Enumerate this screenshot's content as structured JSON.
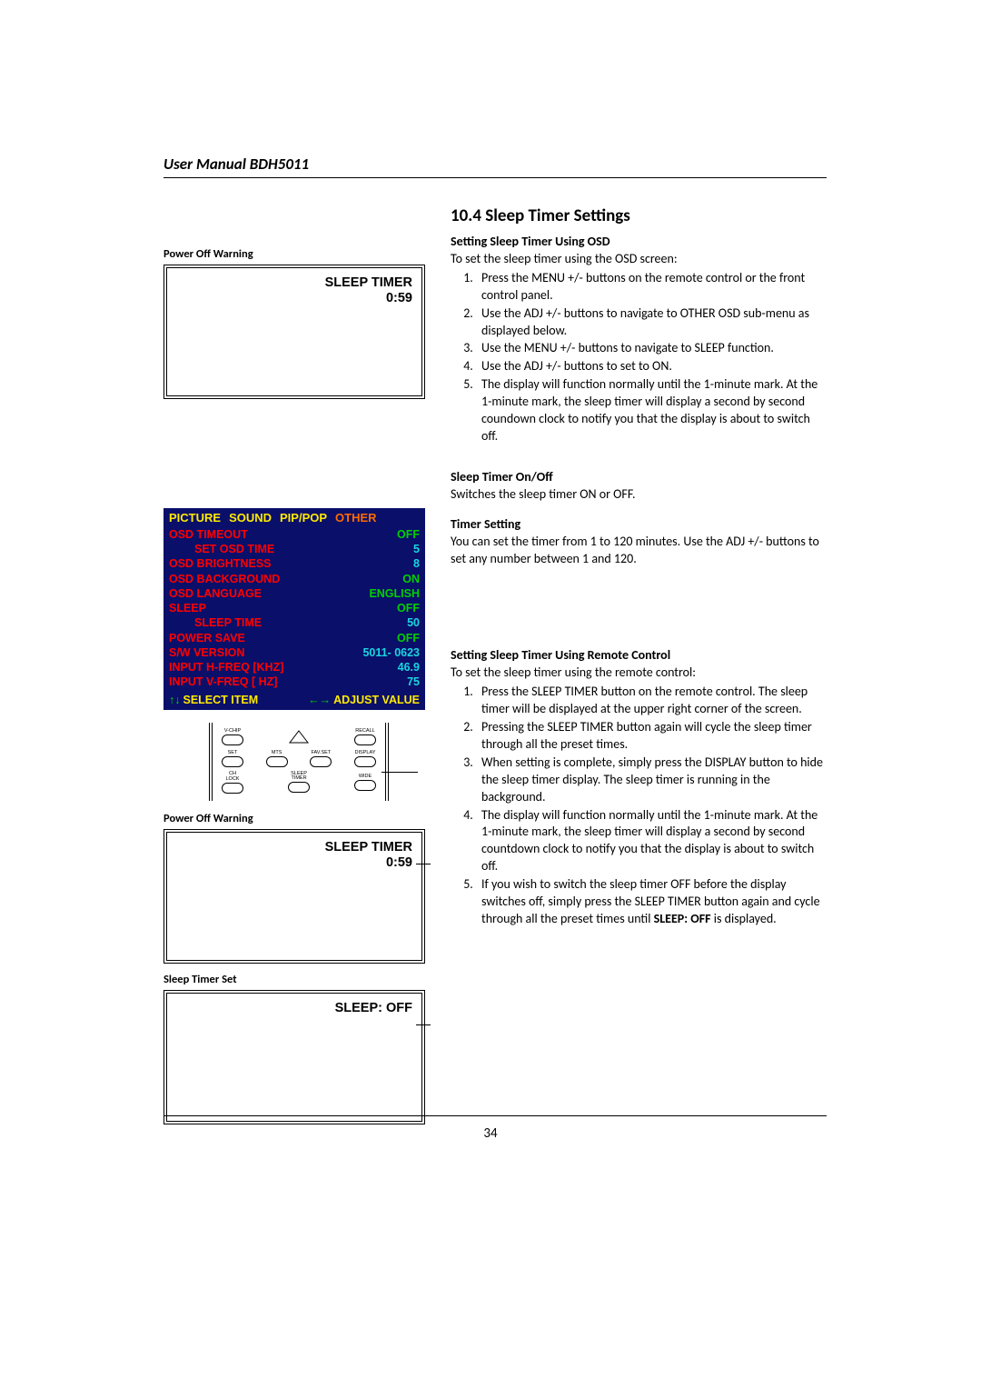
{
  "header": {
    "title": "User Manual BDH5011"
  },
  "section": {
    "number_title": "10.4  Sleep Timer Settings"
  },
  "osd_subtitle": "Setting Sleep Timer Using OSD",
  "osd_intro": "To set the sleep timer using the OSD screen:",
  "osd_steps": [
    "Press the MENU +/- buttons on the remote control or the front control panel.",
    "Use the ADJ +/- buttons to navigate to OTHER OSD sub-menu as displayed below.",
    "Use the MENU +/- buttons to navigate to SLEEP function.",
    "Use the ADJ +/- buttons to set to ON.",
    "The display will function normally until the 1-minute mark.  At the 1-minute mark, the sleep timer will display a second by second coundown clock to notify you that the display is about to switch off."
  ],
  "onoff": {
    "title": "Sleep Timer On/Off",
    "text": "Switches the sleep timer ON or OFF."
  },
  "timer_setting": {
    "title": "Timer Setting",
    "text": "You can set the timer from 1 to 120 minutes. Use the ADJ +/- buttons to set any number between 1 and 120."
  },
  "remote_subtitle": "Setting Sleep Timer Using Remote Control",
  "remote_intro": "To set the sleep timer using the remote control:",
  "remote_steps": [
    "Press the SLEEP TIMER button on the remote control. The sleep timer will be displayed at the upper right corner of the screen.",
    "Pressing the SLEEP TIMER button again will cycle the sleep timer through all the preset times.",
    "When setting is complete, simply press the DISPLAY button to hide the sleep timer display. The sleep timer is running in the background.",
    "The display will function normally until the 1-minute mark.  At the 1-minute mark, the sleep timer will display a second by second countdown clock to notify you that the display is about to switch off.",
    "If you wish to switch the sleep timer OFF before the display switches off, simply press the SLEEP TIMER button again and cycle through all the preset times until SLEEP: OFF is displayed."
  ],
  "figures": {
    "power_off_warning": "Power Off Warning",
    "sleep_timer_set": "Sleep Timer Set",
    "sleep_timer_line1": "SLEEP TIMER",
    "sleep_timer_line2": "0:59",
    "sleep_off": "SLEEP: OFF"
  },
  "osd_menu": {
    "tabs": [
      "PICTURE",
      "SOUND",
      "PIP/POP",
      "OTHER"
    ],
    "lines": [
      {
        "label": "OSD  TIMEOUT",
        "value": "OFF",
        "vclass": "val-green"
      },
      {
        "label": "SET  OSD  TIME",
        "value": "5",
        "vclass": "val-cyan",
        "indent": true
      },
      {
        "label": "OSD  BRIGHTNESS",
        "value": "8",
        "vclass": "val-cyan"
      },
      {
        "label": "OSD  BACKGROUND",
        "value": "ON",
        "vclass": "val-green"
      },
      {
        "label": "OSD  LANGUAGE",
        "value": "ENGLISH",
        "vclass": "val-green"
      },
      {
        "label": "SLEEP",
        "value": "OFF",
        "vclass": "val-green"
      },
      {
        "label": "SLEEP  TIME",
        "value": "50",
        "vclass": "val-cyan",
        "indent": true
      },
      {
        "label": "POWER  SAVE",
        "value": "OFF",
        "vclass": "val-green"
      },
      {
        "label": "S/W  VERSION",
        "value": "5011- 0623",
        "vclass": "val-cyan"
      },
      {
        "label": "INPUT  H-FREQ  [KHZ]",
        "value": "46.9",
        "vclass": "val-cyan"
      },
      {
        "label": "INPUT  V-FREQ  [  HZ]",
        "value": "75",
        "vclass": "val-cyan"
      }
    ],
    "footer_left": "SELECT  ITEM",
    "footer_right": "ADJUST  VALUE"
  },
  "remote_labels": {
    "vchip": "V-CHIP",
    "recall": "RECALL",
    "set": "SET",
    "mts": "MTS",
    "favset": "FAV.SET",
    "display": "DISPLAY",
    "chlock": "CH LOCK",
    "sleep": "SLEEP TIMER",
    "wide": "WIDE"
  },
  "page_number": "34"
}
